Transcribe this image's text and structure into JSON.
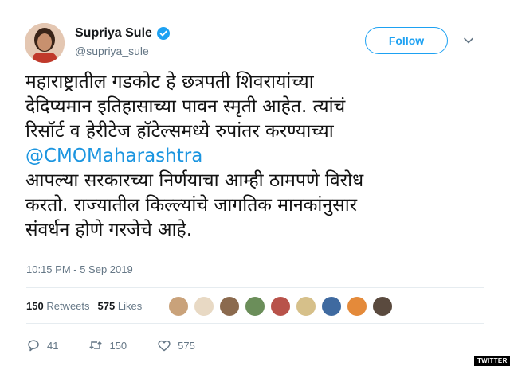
{
  "author": {
    "name": "Supriya Sule",
    "handle": "@supriya_sule",
    "verified_icon": "verified-badge-icon"
  },
  "follow_label": "Follow",
  "tweet": {
    "line1": "महाराष्ट्रातील गडकोट हे छत्रपती शिवरायांच्या",
    "line2": "देदिप्यमान इतिहासाच्या पावन स्मृती आहेत. त्यांचं",
    "line3": "रिसॉर्ट व हेरीटेज हॉटेल्समध्ये रुपांतर करण्याच्या",
    "mention": "@CMOMaharashtra",
    "line5": "आपल्या सरकारच्या निर्णयाचा आम्ही ठामपणे विरोध",
    "line6": "करतो. राज्यातील किल्ल्यांचे जागतिक मानकांनुसार",
    "line7": "संवर्धन होणे गरजेचे आहे."
  },
  "timestamp": "10:15 PM - 5 Sep 2019",
  "stats": {
    "retweets_count": "150",
    "retweets_label": "Retweets",
    "likes_count": "575",
    "likes_label": "Likes"
  },
  "actions": {
    "replies": "41",
    "retweets": "150",
    "likes": "575"
  },
  "colors": {
    "accent": "#1da1f2",
    "mention": "#1b95e0",
    "muted": "#657786"
  },
  "badge": "TWITTER"
}
